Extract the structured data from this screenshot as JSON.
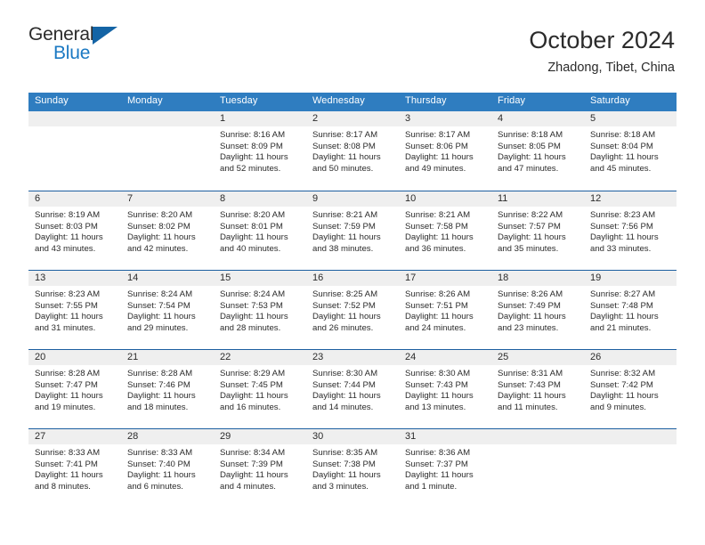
{
  "brand": {
    "name_part1": "General",
    "name_part2": "Blue",
    "triangle_color": "#1464a5",
    "blue_color": "#1b79c3"
  },
  "header": {
    "title": "October 2024",
    "location": "Zhadong, Tibet, China",
    "header_bg": "#2f7dc0",
    "row_divider": "#1d5fa0",
    "daynum_bg": "#efefef"
  },
  "weekdays": [
    "Sunday",
    "Monday",
    "Tuesday",
    "Wednesday",
    "Thursday",
    "Friday",
    "Saturday"
  ],
  "weeks": [
    [
      {
        "day": "",
        "lines": []
      },
      {
        "day": "",
        "lines": []
      },
      {
        "day": "1",
        "lines": [
          "Sunrise: 8:16 AM",
          "Sunset: 8:09 PM",
          "Daylight: 11 hours",
          "and 52 minutes."
        ]
      },
      {
        "day": "2",
        "lines": [
          "Sunrise: 8:17 AM",
          "Sunset: 8:08 PM",
          "Daylight: 11 hours",
          "and 50 minutes."
        ]
      },
      {
        "day": "3",
        "lines": [
          "Sunrise: 8:17 AM",
          "Sunset: 8:06 PM",
          "Daylight: 11 hours",
          "and 49 minutes."
        ]
      },
      {
        "day": "4",
        "lines": [
          "Sunrise: 8:18 AM",
          "Sunset: 8:05 PM",
          "Daylight: 11 hours",
          "and 47 minutes."
        ]
      },
      {
        "day": "5",
        "lines": [
          "Sunrise: 8:18 AM",
          "Sunset: 8:04 PM",
          "Daylight: 11 hours",
          "and 45 minutes."
        ]
      }
    ],
    [
      {
        "day": "6",
        "lines": [
          "Sunrise: 8:19 AM",
          "Sunset: 8:03 PM",
          "Daylight: 11 hours",
          "and 43 minutes."
        ]
      },
      {
        "day": "7",
        "lines": [
          "Sunrise: 8:20 AM",
          "Sunset: 8:02 PM",
          "Daylight: 11 hours",
          "and 42 minutes."
        ]
      },
      {
        "day": "8",
        "lines": [
          "Sunrise: 8:20 AM",
          "Sunset: 8:01 PM",
          "Daylight: 11 hours",
          "and 40 minutes."
        ]
      },
      {
        "day": "9",
        "lines": [
          "Sunrise: 8:21 AM",
          "Sunset: 7:59 PM",
          "Daylight: 11 hours",
          "and 38 minutes."
        ]
      },
      {
        "day": "10",
        "lines": [
          "Sunrise: 8:21 AM",
          "Sunset: 7:58 PM",
          "Daylight: 11 hours",
          "and 36 minutes."
        ]
      },
      {
        "day": "11",
        "lines": [
          "Sunrise: 8:22 AM",
          "Sunset: 7:57 PM",
          "Daylight: 11 hours",
          "and 35 minutes."
        ]
      },
      {
        "day": "12",
        "lines": [
          "Sunrise: 8:23 AM",
          "Sunset: 7:56 PM",
          "Daylight: 11 hours",
          "and 33 minutes."
        ]
      }
    ],
    [
      {
        "day": "13",
        "lines": [
          "Sunrise: 8:23 AM",
          "Sunset: 7:55 PM",
          "Daylight: 11 hours",
          "and 31 minutes."
        ]
      },
      {
        "day": "14",
        "lines": [
          "Sunrise: 8:24 AM",
          "Sunset: 7:54 PM",
          "Daylight: 11 hours",
          "and 29 minutes."
        ]
      },
      {
        "day": "15",
        "lines": [
          "Sunrise: 8:24 AM",
          "Sunset: 7:53 PM",
          "Daylight: 11 hours",
          "and 28 minutes."
        ]
      },
      {
        "day": "16",
        "lines": [
          "Sunrise: 8:25 AM",
          "Sunset: 7:52 PM",
          "Daylight: 11 hours",
          "and 26 minutes."
        ]
      },
      {
        "day": "17",
        "lines": [
          "Sunrise: 8:26 AM",
          "Sunset: 7:51 PM",
          "Daylight: 11 hours",
          "and 24 minutes."
        ]
      },
      {
        "day": "18",
        "lines": [
          "Sunrise: 8:26 AM",
          "Sunset: 7:49 PM",
          "Daylight: 11 hours",
          "and 23 minutes."
        ]
      },
      {
        "day": "19",
        "lines": [
          "Sunrise: 8:27 AM",
          "Sunset: 7:48 PM",
          "Daylight: 11 hours",
          "and 21 minutes."
        ]
      }
    ],
    [
      {
        "day": "20",
        "lines": [
          "Sunrise: 8:28 AM",
          "Sunset: 7:47 PM",
          "Daylight: 11 hours",
          "and 19 minutes."
        ]
      },
      {
        "day": "21",
        "lines": [
          "Sunrise: 8:28 AM",
          "Sunset: 7:46 PM",
          "Daylight: 11 hours",
          "and 18 minutes."
        ]
      },
      {
        "day": "22",
        "lines": [
          "Sunrise: 8:29 AM",
          "Sunset: 7:45 PM",
          "Daylight: 11 hours",
          "and 16 minutes."
        ]
      },
      {
        "day": "23",
        "lines": [
          "Sunrise: 8:30 AM",
          "Sunset: 7:44 PM",
          "Daylight: 11 hours",
          "and 14 minutes."
        ]
      },
      {
        "day": "24",
        "lines": [
          "Sunrise: 8:30 AM",
          "Sunset: 7:43 PM",
          "Daylight: 11 hours",
          "and 13 minutes."
        ]
      },
      {
        "day": "25",
        "lines": [
          "Sunrise: 8:31 AM",
          "Sunset: 7:43 PM",
          "Daylight: 11 hours",
          "and 11 minutes."
        ]
      },
      {
        "day": "26",
        "lines": [
          "Sunrise: 8:32 AM",
          "Sunset: 7:42 PM",
          "Daylight: 11 hours",
          "and 9 minutes."
        ]
      }
    ],
    [
      {
        "day": "27",
        "lines": [
          "Sunrise: 8:33 AM",
          "Sunset: 7:41 PM",
          "Daylight: 11 hours",
          "and 8 minutes."
        ]
      },
      {
        "day": "28",
        "lines": [
          "Sunrise: 8:33 AM",
          "Sunset: 7:40 PM",
          "Daylight: 11 hours",
          "and 6 minutes."
        ]
      },
      {
        "day": "29",
        "lines": [
          "Sunrise: 8:34 AM",
          "Sunset: 7:39 PM",
          "Daylight: 11 hours",
          "and 4 minutes."
        ]
      },
      {
        "day": "30",
        "lines": [
          "Sunrise: 8:35 AM",
          "Sunset: 7:38 PM",
          "Daylight: 11 hours",
          "and 3 minutes."
        ]
      },
      {
        "day": "31",
        "lines": [
          "Sunrise: 8:36 AM",
          "Sunset: 7:37 PM",
          "Daylight: 11 hours",
          "and 1 minute."
        ]
      },
      {
        "day": "",
        "lines": []
      },
      {
        "day": "",
        "lines": []
      }
    ]
  ]
}
